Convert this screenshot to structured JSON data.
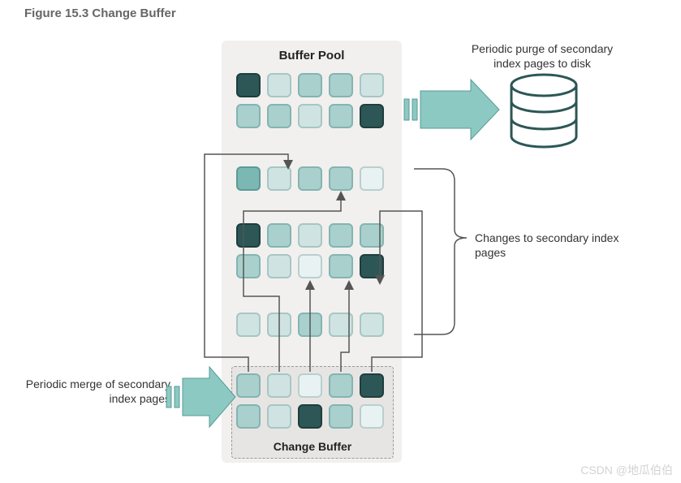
{
  "figure_title": "Figure 15.3 Change Buffer",
  "buffer_pool_label": "Buffer Pool",
  "change_buffer_label": "Change Buffer",
  "label_purge": "Periodic purge of secondary index pages to disk",
  "label_changes": "Changes to secondary index pages",
  "label_merge": "Periodic merge of secondary index pages",
  "watermark": "CSDN @地瓜伯伯",
  "colors": {
    "panel_fill": "#f1f0ef",
    "dashed_fill": "#e7e5e3",
    "arrow_fill": "#8cc9c3",
    "arrow_stroke": "#5a9a96",
    "disk_stroke": "#2c5756",
    "connector": "#555555"
  },
  "legend": {
    "c0": "very light teal",
    "c1": "light teal",
    "c2": "teal",
    "c3": "medium teal",
    "c4": "dark teal",
    "c5": "very dark teal"
  },
  "grids": {
    "pool_top": [
      [
        "c5",
        "c1",
        "c2",
        "c2",
        "c1"
      ],
      [
        "c2",
        "c2",
        "c1",
        "c2",
        "c5"
      ]
    ],
    "pool_mid1": [
      [
        "c3",
        "c1",
        "c2",
        "c2",
        "c0"
      ]
    ],
    "pool_mid2": [
      [
        "c5",
        "c2",
        "c1",
        "c2",
        "c2"
      ],
      [
        "c2",
        "c1",
        "c0",
        "c2",
        "c5"
      ]
    ],
    "pool_bot": [
      [
        "c1",
        "c1",
        "c2",
        "c1",
        "c1"
      ]
    ],
    "change_buf": [
      [
        "c2",
        "c1",
        "c0",
        "c2",
        "c5"
      ],
      [
        "c2",
        "c1",
        "c5",
        "c2",
        "c0"
      ]
    ]
  }
}
